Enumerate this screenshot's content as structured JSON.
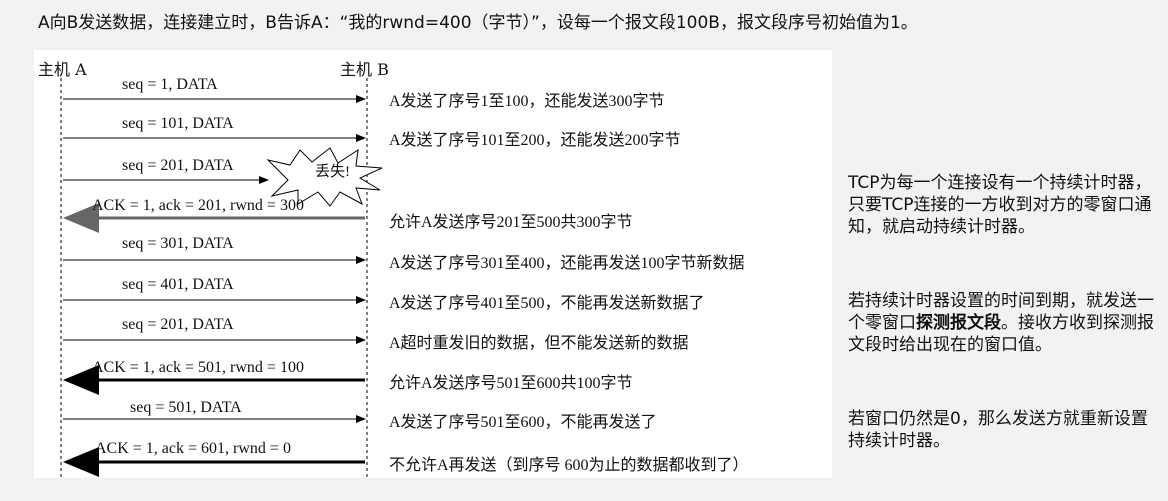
{
  "title": "A向B发送数据，连接建立时，B告诉A：“我的rwnd=400（字节）”，设每一个报文段100B，报文段序号初始值为1。",
  "hosts": {
    "a": "主机 A",
    "b": "主机 B"
  },
  "lost_label": "丢失!",
  "messages": [
    {
      "label": "seq = 1, DATA",
      "direction": "A→B",
      "desc": "A发送了序号1至100，还能发送300字节"
    },
    {
      "label": "seq = 101, DATA",
      "direction": "A→B",
      "desc": "A发送了序号101至200，还能发送200字节"
    },
    {
      "label": "seq = 201, DATA",
      "direction": "A→B",
      "desc": "",
      "lost": true
    },
    {
      "label": "ACK = 1, ack = 201, rwnd = 300",
      "direction": "B→A",
      "desc": "允许A发送序号201至500共300字节"
    },
    {
      "label": "seq = 301, DATA",
      "direction": "A→B",
      "desc": "A发送了序号301至400，还能再发送100字节新数据"
    },
    {
      "label": "seq = 401, DATA",
      "direction": "A→B",
      "desc": "A发送了序号401至500，不能再发送新数据了"
    },
    {
      "label": "seq = 201, DATA",
      "direction": "A→B",
      "desc": "A超时重发旧的数据，但不能发送新的数据"
    },
    {
      "label": "ACK = 1, ack = 501, rwnd = 100",
      "direction": "B→A",
      "desc": "允许A发送序号501至600共100字节"
    },
    {
      "label": "seq = 501, DATA",
      "direction": "A→B",
      "desc": "A发送了序号501至600，不能再发送了"
    },
    {
      "label": "ACK = 1, ack = 601, rwnd = 0",
      "direction": "B→A",
      "desc": "不允许A再发送（到序号 600为止的数据都收到了）"
    }
  ],
  "notes": {
    "n1": "TCP为每一个连接设有一个持续计时器，只要TCP连接的一方收到对方的零窗口通知，就启动持续计时器。",
    "n2_pre": "若持续计时器设置的时间到期，就发送一个零窗口",
    "n2_bold": "探测报文段",
    "n2_post": "。接收方收到探测报文段时给出现在的窗口值。",
    "n3": "若窗口仍然是0，那么发送方就重新设置持续计时器。"
  },
  "colors": {
    "ack_arrow": "#666666",
    "ack_arrow_strong": "#000000",
    "data_arrow": "#000000"
  }
}
